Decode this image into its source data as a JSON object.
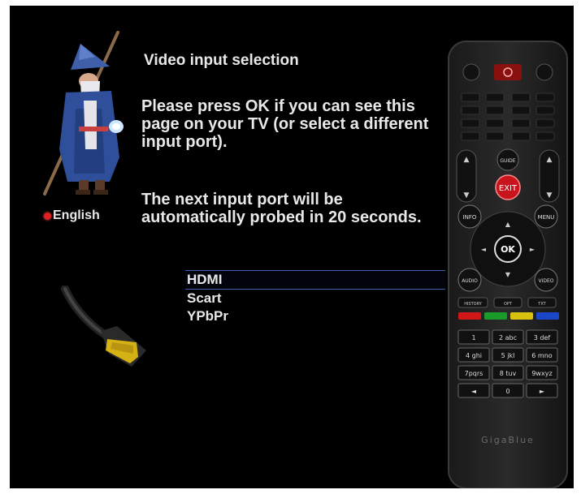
{
  "wizard": {
    "title": "Video input selection",
    "instructions": "Please press OK if you can see this page on your TV (or select a different input port).",
    "countdown": "The next input port will be automatically probed in 20 seconds.",
    "language": "English"
  },
  "ports": {
    "items": [
      "HDMI",
      "Scart",
      "YPbPr"
    ],
    "selected": "HDMI"
  },
  "remote": {
    "brand": "GigaBlue",
    "exit_label": "EXIT",
    "ok_label": "OK",
    "guide_label": "GUIDE",
    "info_label": "INFO",
    "menu_label": "MENU",
    "audio_label": "AUDIO",
    "video_label": "VIDEO",
    "history_label": "HISTORY",
    "opt_label": "OPT",
    "txt_label": "TXT",
    "keys": [
      "1",
      "2 abc",
      "3 def",
      "4 ghi",
      "5 jkl",
      "6 mno",
      "7pqrs",
      "8 tuv",
      "9wxyz",
      "◄",
      "0",
      "►"
    ]
  },
  "colors": {
    "background": "#000000",
    "text": "#e8e8e8",
    "separator": "#3c5fb0",
    "exit_button": "#c8141c",
    "key_red": "#d01818",
    "key_green": "#1a9a2a",
    "key_yellow": "#d8c010",
    "key_blue": "#1a46c8"
  }
}
